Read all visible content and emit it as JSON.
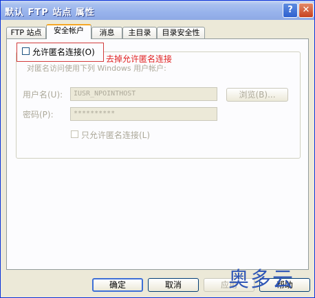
{
  "window": {
    "title": "默认 FTP 站点 属性"
  },
  "titlebar": {
    "help_glyph": "?",
    "close_glyph": "✕"
  },
  "tabs": [
    {
      "label": "FTP 站点",
      "active": false
    },
    {
      "label": "安全帐户",
      "active": true
    },
    {
      "label": "消息",
      "active": false
    },
    {
      "label": "主目录",
      "active": false
    },
    {
      "label": "目录安全性",
      "active": false
    }
  ],
  "anonymous": {
    "allow_label": "允许匿名连接(O)",
    "allow_checked": false,
    "annotation": "去掉允许匿名连接",
    "group_caption": "对匿名访问使用下列 Windows 用户帐户:",
    "username_label": "用户名(U):",
    "username_value": "IUSR_NPOINTHOST",
    "browse_label": "浏览(B)...",
    "password_label": "密码(P):",
    "password_value": "**********",
    "only_anon_label": "只允许匿名连接(L)"
  },
  "buttons": {
    "ok": "确定",
    "cancel": "取消",
    "apply": "应用",
    "help": "帮助"
  },
  "watermark": "奥多云",
  "colors": {
    "annotation": "#e02020",
    "highlight_box": "#d23a3a",
    "active_tab": "#f5a623",
    "titlebar": "#98b3ec"
  }
}
